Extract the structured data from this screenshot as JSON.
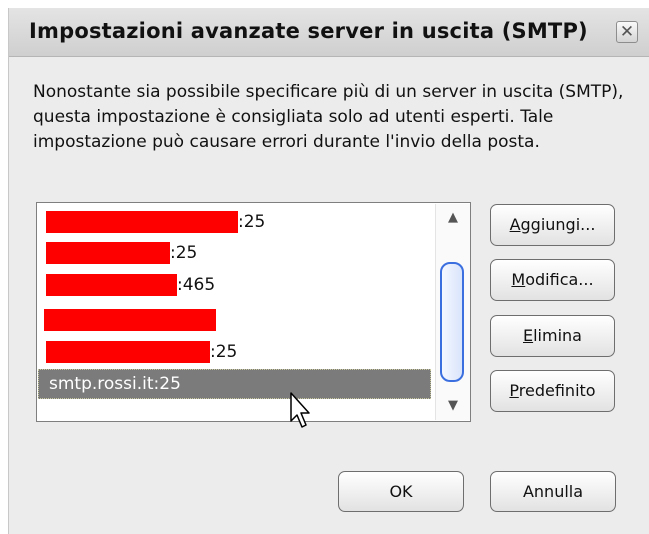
{
  "dialog": {
    "title": "Impostazioni avanzate server in uscita (SMTP)",
    "close_glyph": "✕",
    "description": "Nonostante sia possibile specificare più di un server in uscita (SMTP), questa impostazione è consigliata solo ad utenti esperti. Tale impostazione può causare errori durante l'invio della posta."
  },
  "server_list": {
    "items": [
      {
        "host": "[redacted]",
        "port": ":25"
      },
      {
        "host": "[redacted]",
        "port": ":25"
      },
      {
        "host": "[redacted]",
        "port": ":465"
      },
      {
        "host": "[redacted]",
        "port": ""
      },
      {
        "host": "[redacted]",
        "port": ":25"
      },
      {
        "host": "smtp.rossi.it:25",
        "port": "",
        "selected": true
      }
    ],
    "scroll_up_glyph": "▲",
    "scroll_down_glyph": "▼"
  },
  "buttons": {
    "add": {
      "prefix": "A",
      "rest": "ggiungi..."
    },
    "edit": {
      "prefix": "M",
      "rest": "odifica..."
    },
    "delete": {
      "prefix": "E",
      "rest": "limina"
    },
    "default": {
      "prefix": "P",
      "rest": "redefinito"
    },
    "ok": "OK",
    "cancel": "Annulla"
  },
  "colors": {
    "redaction": "#ff0000",
    "selection_bg": "#7b7b7b",
    "scroll_thumb_border": "#3b6fe0"
  },
  "icons": {
    "cursor": "mouse-pointer-icon"
  }
}
